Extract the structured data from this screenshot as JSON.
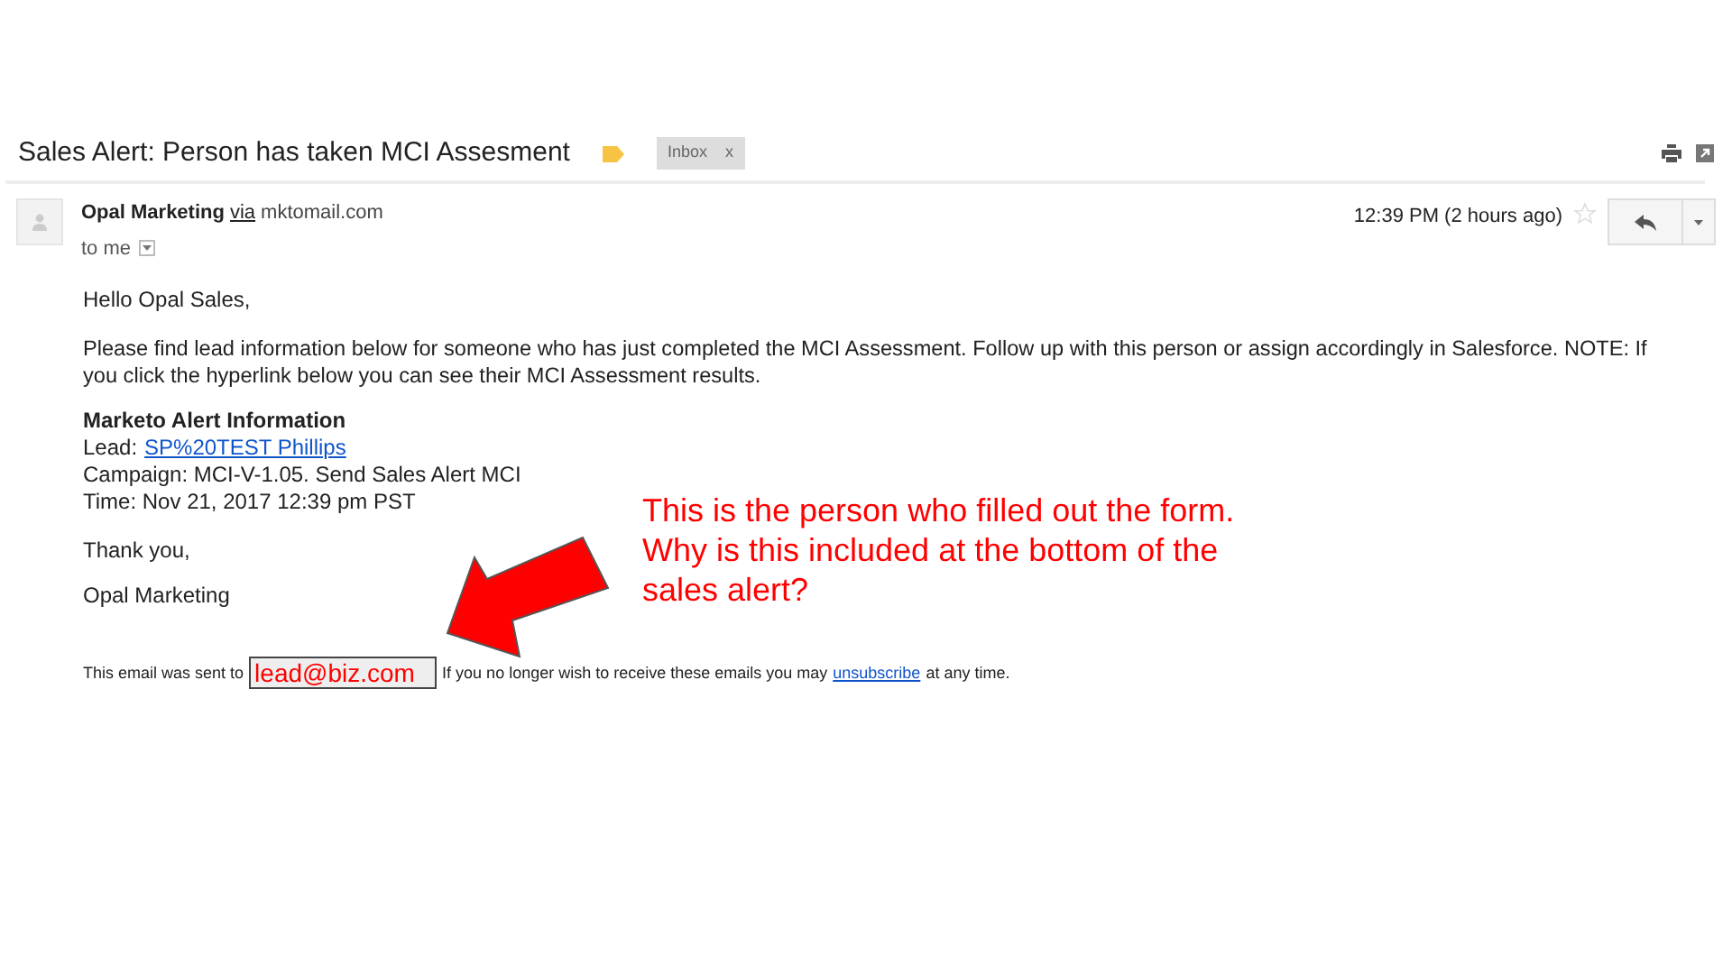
{
  "subject": "Sales Alert: Person has taken MCI Assesment",
  "labels": [
    {
      "text": "Inbox",
      "close": "x"
    }
  ],
  "sender": {
    "name": "Opal Marketing",
    "via": "via",
    "domain": "mktomail.com",
    "recipient": "to me",
    "time": "12:39 PM (2 hours ago)",
    "starred": false
  },
  "body": {
    "greeting": "Hello Opal Sales,",
    "paragraph": "Please find lead information below for someone who has just completed the MCI Assessment. Follow up with this person or assign accordingly in Salesforce. NOTE: If you click the hyperlink below you can see their MCI Assessment results.",
    "info_heading": "Marketo Alert Information",
    "lead_label": "Lead:",
    "lead_link": "SP%20TEST Phillips",
    "campaign": "Campaign: MCI-V-1.05. Send Sales Alert MCI",
    "time": "Time: Nov 21, 2017 12:39 pm PST",
    "closing": "Thank you,",
    "signature": "Opal Marketing"
  },
  "footer": {
    "before": "This email was sent to",
    "email": "lead@biz.com",
    "after": "If you no longer wish to receive these emails you may",
    "link": "unsubscribe",
    "end": "at any time."
  },
  "annotation": {
    "text": "This is the person who filled out the form. Why is this included at the bottom of the sales alert?"
  }
}
